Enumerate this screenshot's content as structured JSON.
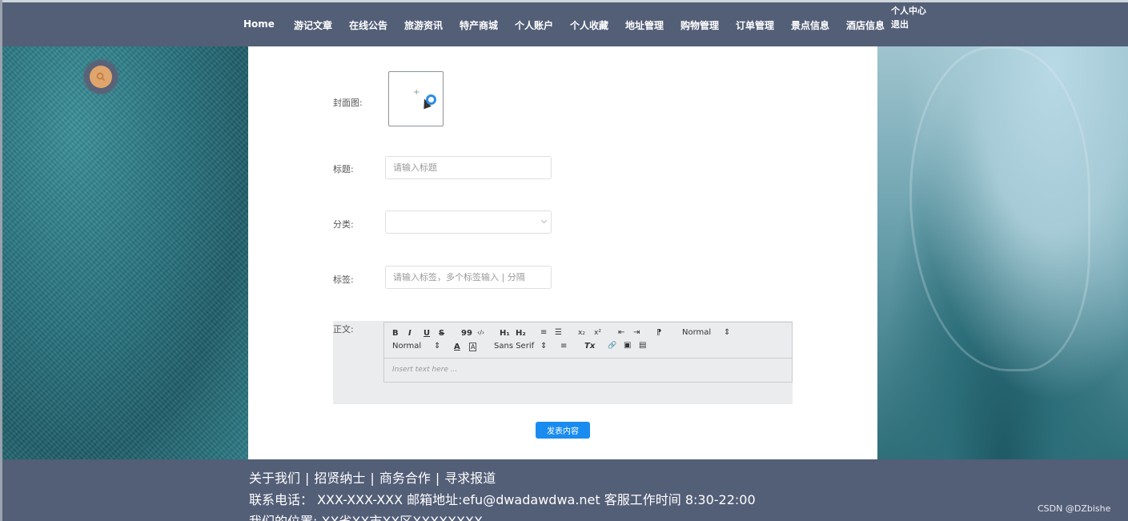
{
  "nav": {
    "items": [
      "Home",
      "游记文章",
      "在线公告",
      "旅游资讯",
      "特产商城",
      "个人账户",
      "个人收藏",
      "地址管理",
      "购物管理",
      "订单管理",
      "景点信息",
      "酒店信息"
    ],
    "user_center": "个人中心",
    "logout": "退出"
  },
  "form": {
    "cover_label": "封面图:",
    "cover_plus": "+",
    "title_label": "标题:",
    "title_placeholder": "请输入标题",
    "category_label": "分类:",
    "category_value": "",
    "tags_label": "标签:",
    "tags_placeholder": "请输入标签，多个标签输入 | 分隔",
    "content_label": "正文:",
    "submit_label": "发表内容"
  },
  "editor": {
    "toolbar": {
      "bold": "B",
      "italic": "I",
      "underline": "U",
      "strike": "S",
      "blockquote": "99",
      "code": "‹/›",
      "h1": "H₁",
      "h2": "H₂",
      "ordered_list": "≡",
      "bullet_list": "☰",
      "subscript": "x₂",
      "superscript": "x²",
      "outdent": "⇤",
      "indent": "⇥",
      "rtl": "⁋",
      "size_select": "Normal",
      "header_select": "Normal",
      "color": "A",
      "background": "A",
      "font_select": "Sans Serif",
      "align": "≡",
      "clean": "Tx",
      "link": "🔗",
      "image": "▣",
      "video": "▤"
    },
    "placeholder": "Insert text here ..."
  },
  "footer": {
    "links": [
      "关于我们",
      "招贤纳士",
      "商务合作",
      "寻求报道"
    ],
    "separator": "|",
    "contact": "联系电话： XXX-XXX-XXX 邮箱地址:efu@dwadawdwa.net 客服工作时间 8:30-22:00",
    "address": "我们的位置: XX省XX市XX区XXXXXXXX"
  },
  "watermark": "CSDN @DZbishe",
  "colors": {
    "nav_bg": "#535e77",
    "accent": "#1a8cf0",
    "search_badge": "#e0a56c"
  }
}
